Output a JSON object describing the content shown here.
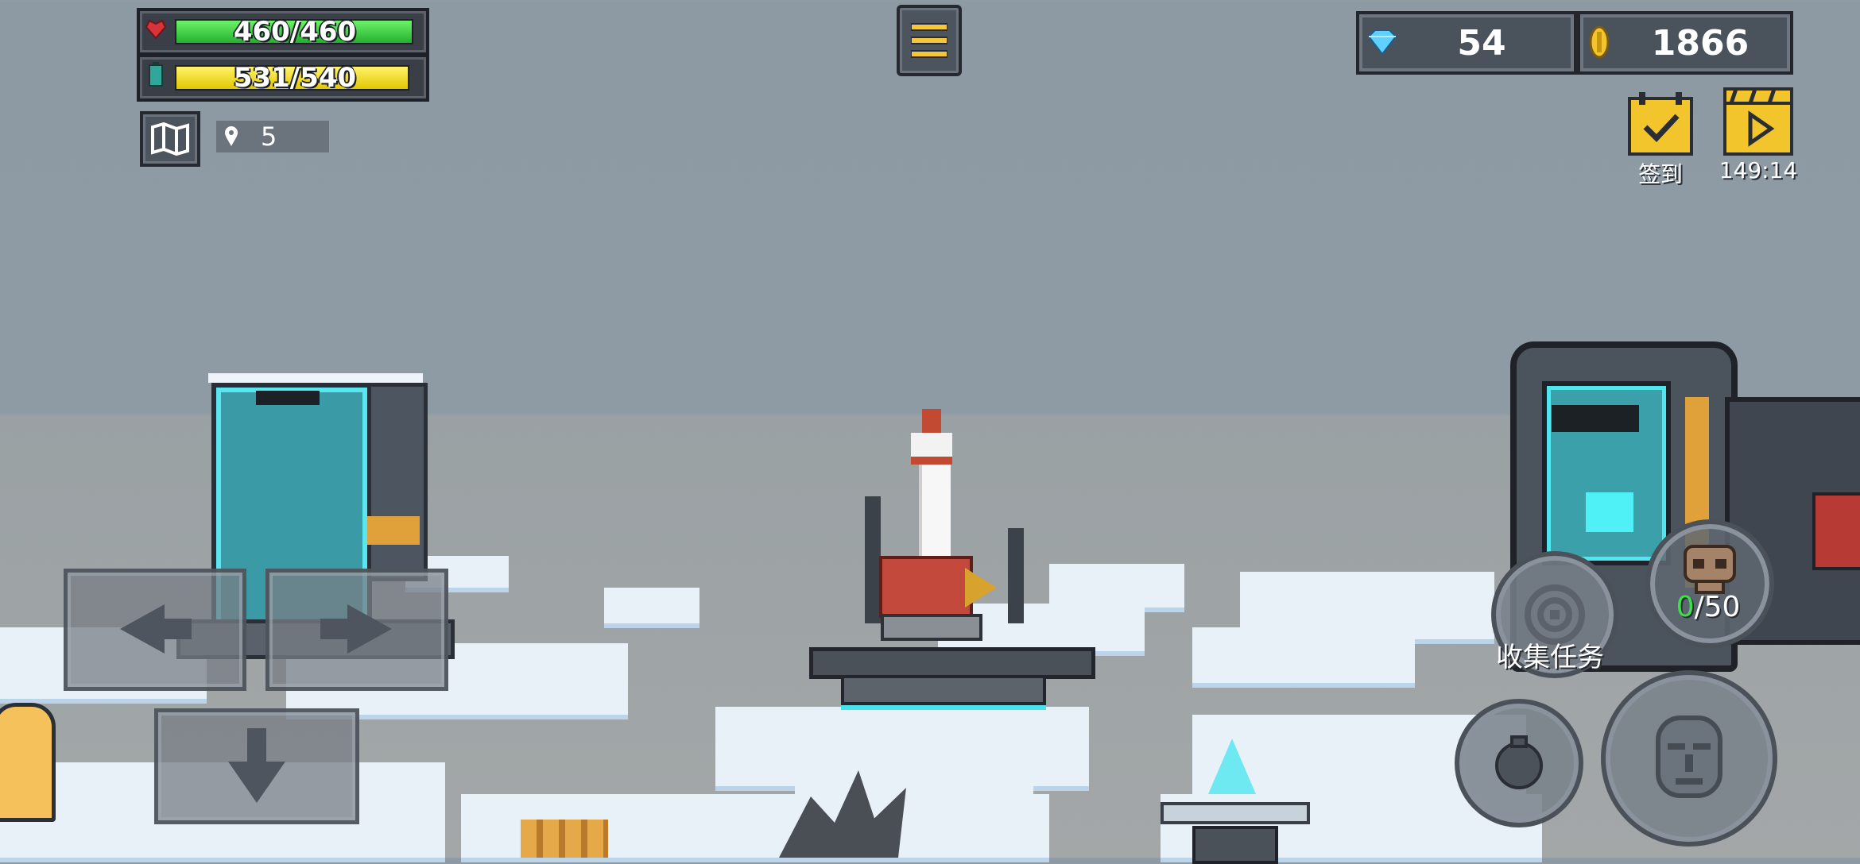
{
  "hud": {
    "health": {
      "text": "460/460",
      "current": 460,
      "max": 460,
      "color": "#2fc43a"
    },
    "energy": {
      "text": "531/540",
      "current": 531,
      "max": 540,
      "color": "#f2e21b"
    },
    "map_button_icon": "map-icon",
    "location": {
      "icon": "location-pin-icon",
      "value": "5"
    },
    "menu_icon": "hamburger-menu-icon"
  },
  "currency": {
    "gems": {
      "icon": "diamond-icon",
      "value": "54"
    },
    "coins": {
      "icon": "coin-icon",
      "value": "1866"
    }
  },
  "top_right": {
    "checkin": {
      "icon": "calendar-check-icon",
      "label": "签到"
    },
    "video": {
      "icon": "video-play-icon",
      "timer": "149:14"
    }
  },
  "collect_task": {
    "label": "收集任务",
    "icon": "target-icon"
  },
  "task_counter": {
    "current": "0",
    "sep_max": "/50",
    "current_color": "#3ee04a"
  },
  "controls": {
    "left": "arrow-left-icon",
    "right": "arrow-right-icon",
    "down": "arrow-down-icon",
    "bomb": "bomb-icon",
    "face": "stone-face-icon"
  }
}
